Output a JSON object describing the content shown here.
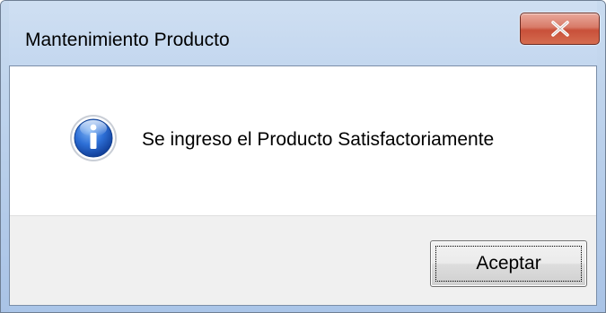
{
  "window": {
    "title": "Mantenimiento Producto"
  },
  "titlebar": {
    "close_icon": "close-x-icon"
  },
  "dialog": {
    "icon": "information-icon",
    "message": "Se ingreso el Producto Satisfactoriamente",
    "ok_label": "Aceptar"
  },
  "colors": {
    "close_button": "#c8503a",
    "info_icon": "#1f5bbf",
    "button_area_bg": "#f0f0f0"
  }
}
